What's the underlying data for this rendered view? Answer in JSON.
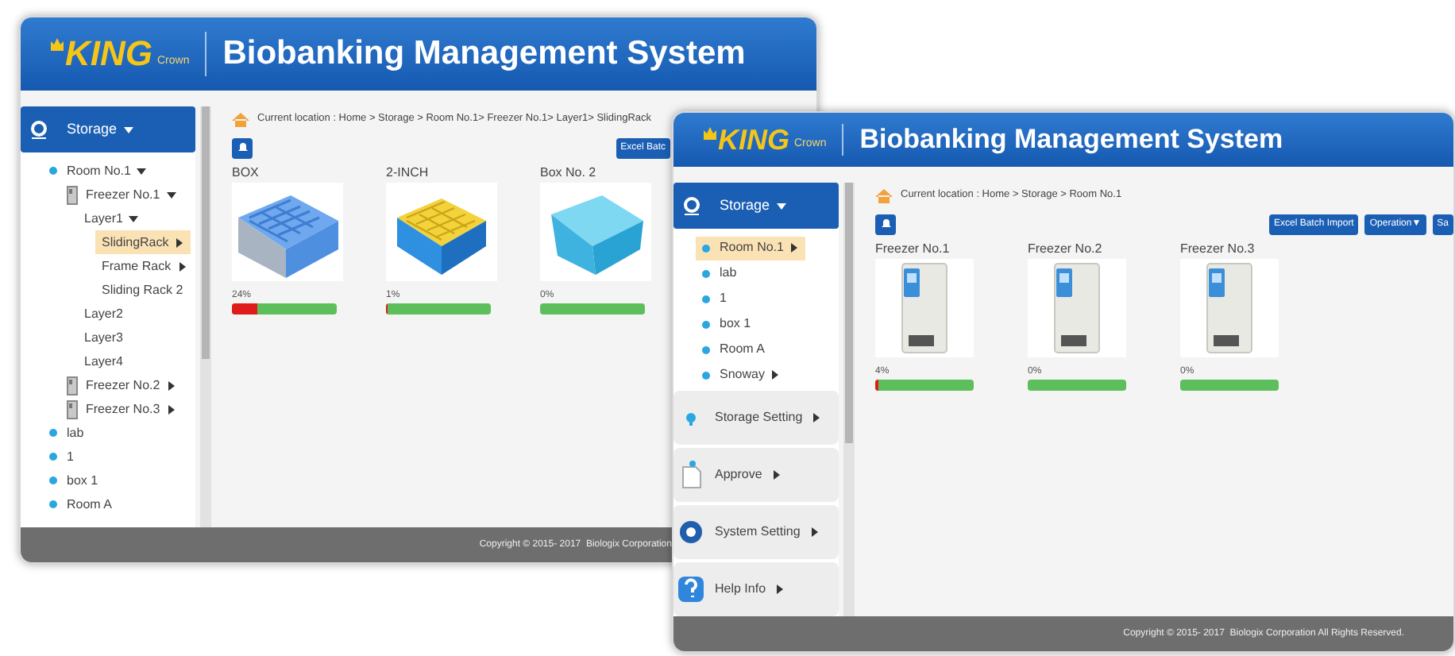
{
  "windows": [
    {
      "kind": "back",
      "logo": {
        "text": "KING",
        "sub": "Crown"
      },
      "title": "Biobanking Management System",
      "sidebar": {
        "header": "Storage",
        "tree": [
          {
            "label": "Room No.1",
            "kind": "room",
            "expanded": true,
            "selected": false,
            "children": [
              {
                "label": "Freezer No.1",
                "kind": "freezer",
                "expanded": true,
                "selected": false,
                "children": [
                  {
                    "label": "Layer1",
                    "expanded": true,
                    "selected": false,
                    "children": [
                      {
                        "label": "SlidingRack",
                        "expanded": false,
                        "selected": true
                      },
                      {
                        "label": "Frame Rack",
                        "expanded": false,
                        "selected": false
                      },
                      {
                        "label": "Sliding Rack 2",
                        "selected": false
                      }
                    ]
                  },
                  {
                    "label": "Layer2",
                    "selected": false
                  },
                  {
                    "label": "Layer3",
                    "selected": false
                  },
                  {
                    "label": "Layer4",
                    "selected": false
                  }
                ]
              },
              {
                "label": "Freezer No.2",
                "kind": "freezer",
                "expanded": false,
                "selected": false
              },
              {
                "label": "Freezer No.3",
                "kind": "freezer",
                "expanded": false,
                "selected": false
              }
            ]
          },
          {
            "label": "lab",
            "kind": "room",
            "selected": false
          },
          {
            "label": "1",
            "kind": "room",
            "selected": false
          },
          {
            "label": "box 1",
            "kind": "room",
            "selected": false
          },
          {
            "label": "Room A",
            "kind": "room",
            "selected": false
          }
        ]
      },
      "breadcrumb": "Current location : Home > Storage > Room No.1> Freezer No.1> Layer1> SlidingRack",
      "buttons": [
        "Excel Batc"
      ],
      "cards": [
        {
          "label": "BOX",
          "kind": "blue-rack",
          "percent": "24%",
          "level": 0.24
        },
        {
          "label": "2-INCH",
          "kind": "yellow-rack",
          "percent": "1%",
          "level": 0.01
        },
        {
          "label": "Box No. 2",
          "kind": "closed-box",
          "percent": "0%",
          "level": 0
        }
      ],
      "footer": "Copyright © 2015- 2017  Biologix Corporation"
    },
    {
      "kind": "front",
      "logo": {
        "text": "KING",
        "sub": "Crown"
      },
      "title": "Biobanking Management System",
      "sidebar": {
        "header": "Storage",
        "tree": [
          {
            "label": "Room No.1",
            "kind": "room",
            "expanded": false,
            "selected": true
          },
          {
            "label": "lab",
            "kind": "room",
            "selected": false
          },
          {
            "label": "1",
            "kind": "room",
            "selected": false
          },
          {
            "label": "box 1",
            "kind": "room",
            "selected": false
          },
          {
            "label": "Room A",
            "kind": "room",
            "selected": false
          },
          {
            "label": "Snoway",
            "kind": "room",
            "expanded": false,
            "selected": false
          }
        ],
        "sections": [
          {
            "label": "Storage Setting",
            "kind": "storage"
          },
          {
            "label": "Approve",
            "kind": "approve"
          },
          {
            "label": "System Setting",
            "kind": "system"
          },
          {
            "label": "Help Info",
            "kind": "help"
          }
        ]
      },
      "breadcrumb": "Current location : Home > Storage > Room No.1",
      "buttons": [
        "Excel Batch Import",
        "Operation▼",
        "Sa"
      ],
      "cards": [
        {
          "label": "Freezer No.1",
          "kind": "freezer",
          "percent": "4%",
          "level": 0.04
        },
        {
          "label": "Freezer No.2",
          "kind": "freezer",
          "percent": "0%",
          "level": 0
        },
        {
          "label": "Freezer No.3",
          "kind": "freezer",
          "percent": "0%",
          "level": 0
        }
      ],
      "footer": "Copyright © 2015- 2017  Biologix Corporation All Rights Reserved."
    }
  ]
}
